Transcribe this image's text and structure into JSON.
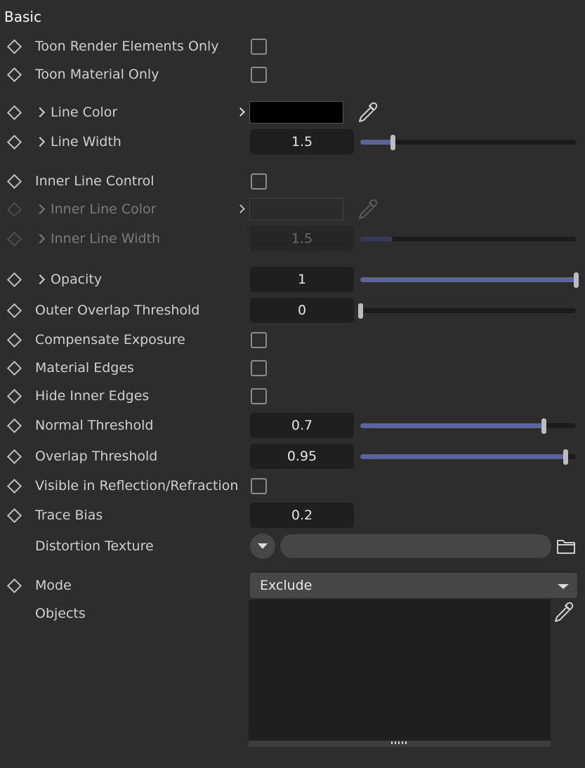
{
  "section": {
    "title": "Basic"
  },
  "rows": {
    "toon_render_elements_only": {
      "label": "Toon Render Elements Only",
      "checked": false
    },
    "toon_material_only": {
      "label": "Toon Material Only",
      "checked": false
    },
    "line_color": {
      "label": "Line Color",
      "color": "#000000"
    },
    "line_width": {
      "label": "Line Width",
      "value": "1.5",
      "slider_fraction": 0.15
    },
    "inner_line_control": {
      "label": "Inner Line Control",
      "checked": false
    },
    "inner_line_color": {
      "label": "Inner Line Color",
      "color": "#2b2b2b",
      "disabled": true
    },
    "inner_line_width": {
      "label": "Inner Line Width",
      "value": "1.5",
      "slider_fraction": 0.15,
      "disabled": true
    },
    "opacity": {
      "label": "Opacity",
      "value": "1",
      "slider_fraction": 1.0
    },
    "outer_overlap_threshold": {
      "label": "Outer Overlap Threshold",
      "value": "0",
      "slider_fraction": 0.0
    },
    "compensate_exposure": {
      "label": "Compensate Exposure",
      "checked": false
    },
    "material_edges": {
      "label": "Material Edges",
      "checked": false
    },
    "hide_inner_edges": {
      "label": "Hide Inner Edges",
      "checked": false
    },
    "normal_threshold": {
      "label": "Normal Threshold",
      "value": "0.7",
      "slider_fraction": 0.85
    },
    "overlap_threshold": {
      "label": "Overlap Threshold",
      "value": "0.95",
      "slider_fraction": 0.95
    },
    "visible_in_reflection_refraction": {
      "label": "Visible in Reflection/Refraction",
      "checked": false
    },
    "trace_bias": {
      "label": "Trace Bias",
      "value": "0.2"
    },
    "distortion_texture": {
      "label": "Distortion Texture",
      "value": ""
    },
    "mode": {
      "label": "Mode",
      "selected": "Exclude"
    },
    "objects": {
      "label": "Objects"
    }
  },
  "icons": {
    "keyframe": "diamond-keyframe-icon",
    "expand": "chevron-right-icon",
    "picker": "eyedropper-icon",
    "folder": "folder-icon",
    "dropdown": "triangle-down-icon"
  },
  "colors": {
    "background": "#2d2d2d",
    "field": "#1f1f1f",
    "slider_fill": "#5b63a6",
    "text": "#cfcfcf"
  }
}
